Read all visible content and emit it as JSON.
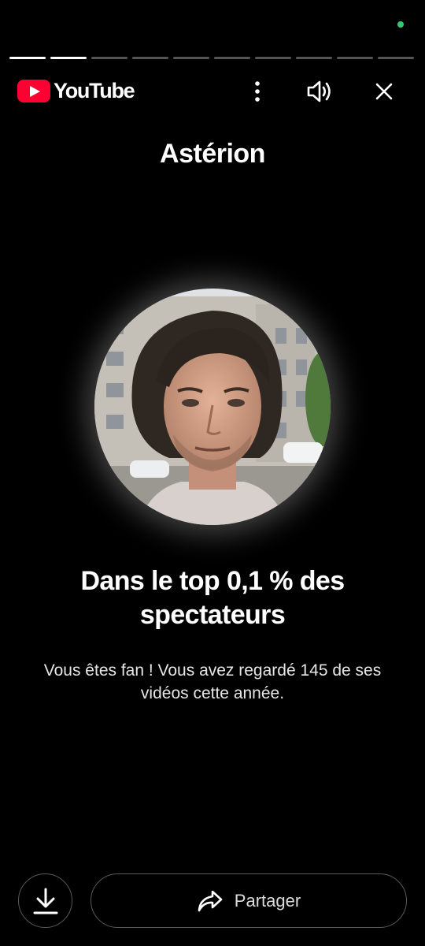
{
  "status": {
    "indicator_color": "#2ecc71"
  },
  "story_progress": {
    "total_segments": 10,
    "completed_segments": 2
  },
  "header": {
    "brand_name": "YouTube",
    "brand_color": "#ff0033",
    "more_icon": "more-vertical-icon",
    "sound_icon": "volume-icon",
    "close_icon": "close-icon"
  },
  "card": {
    "channel_name": "Astérion",
    "headline": "Dans le top 0,1 % des spectateurs",
    "description": "Vous êtes fan ! Vous avez regardé 145 de ses vidéos cette année."
  },
  "actions": {
    "download_icon": "download-icon",
    "share_icon": "share-icon",
    "share_label": "Partager"
  }
}
